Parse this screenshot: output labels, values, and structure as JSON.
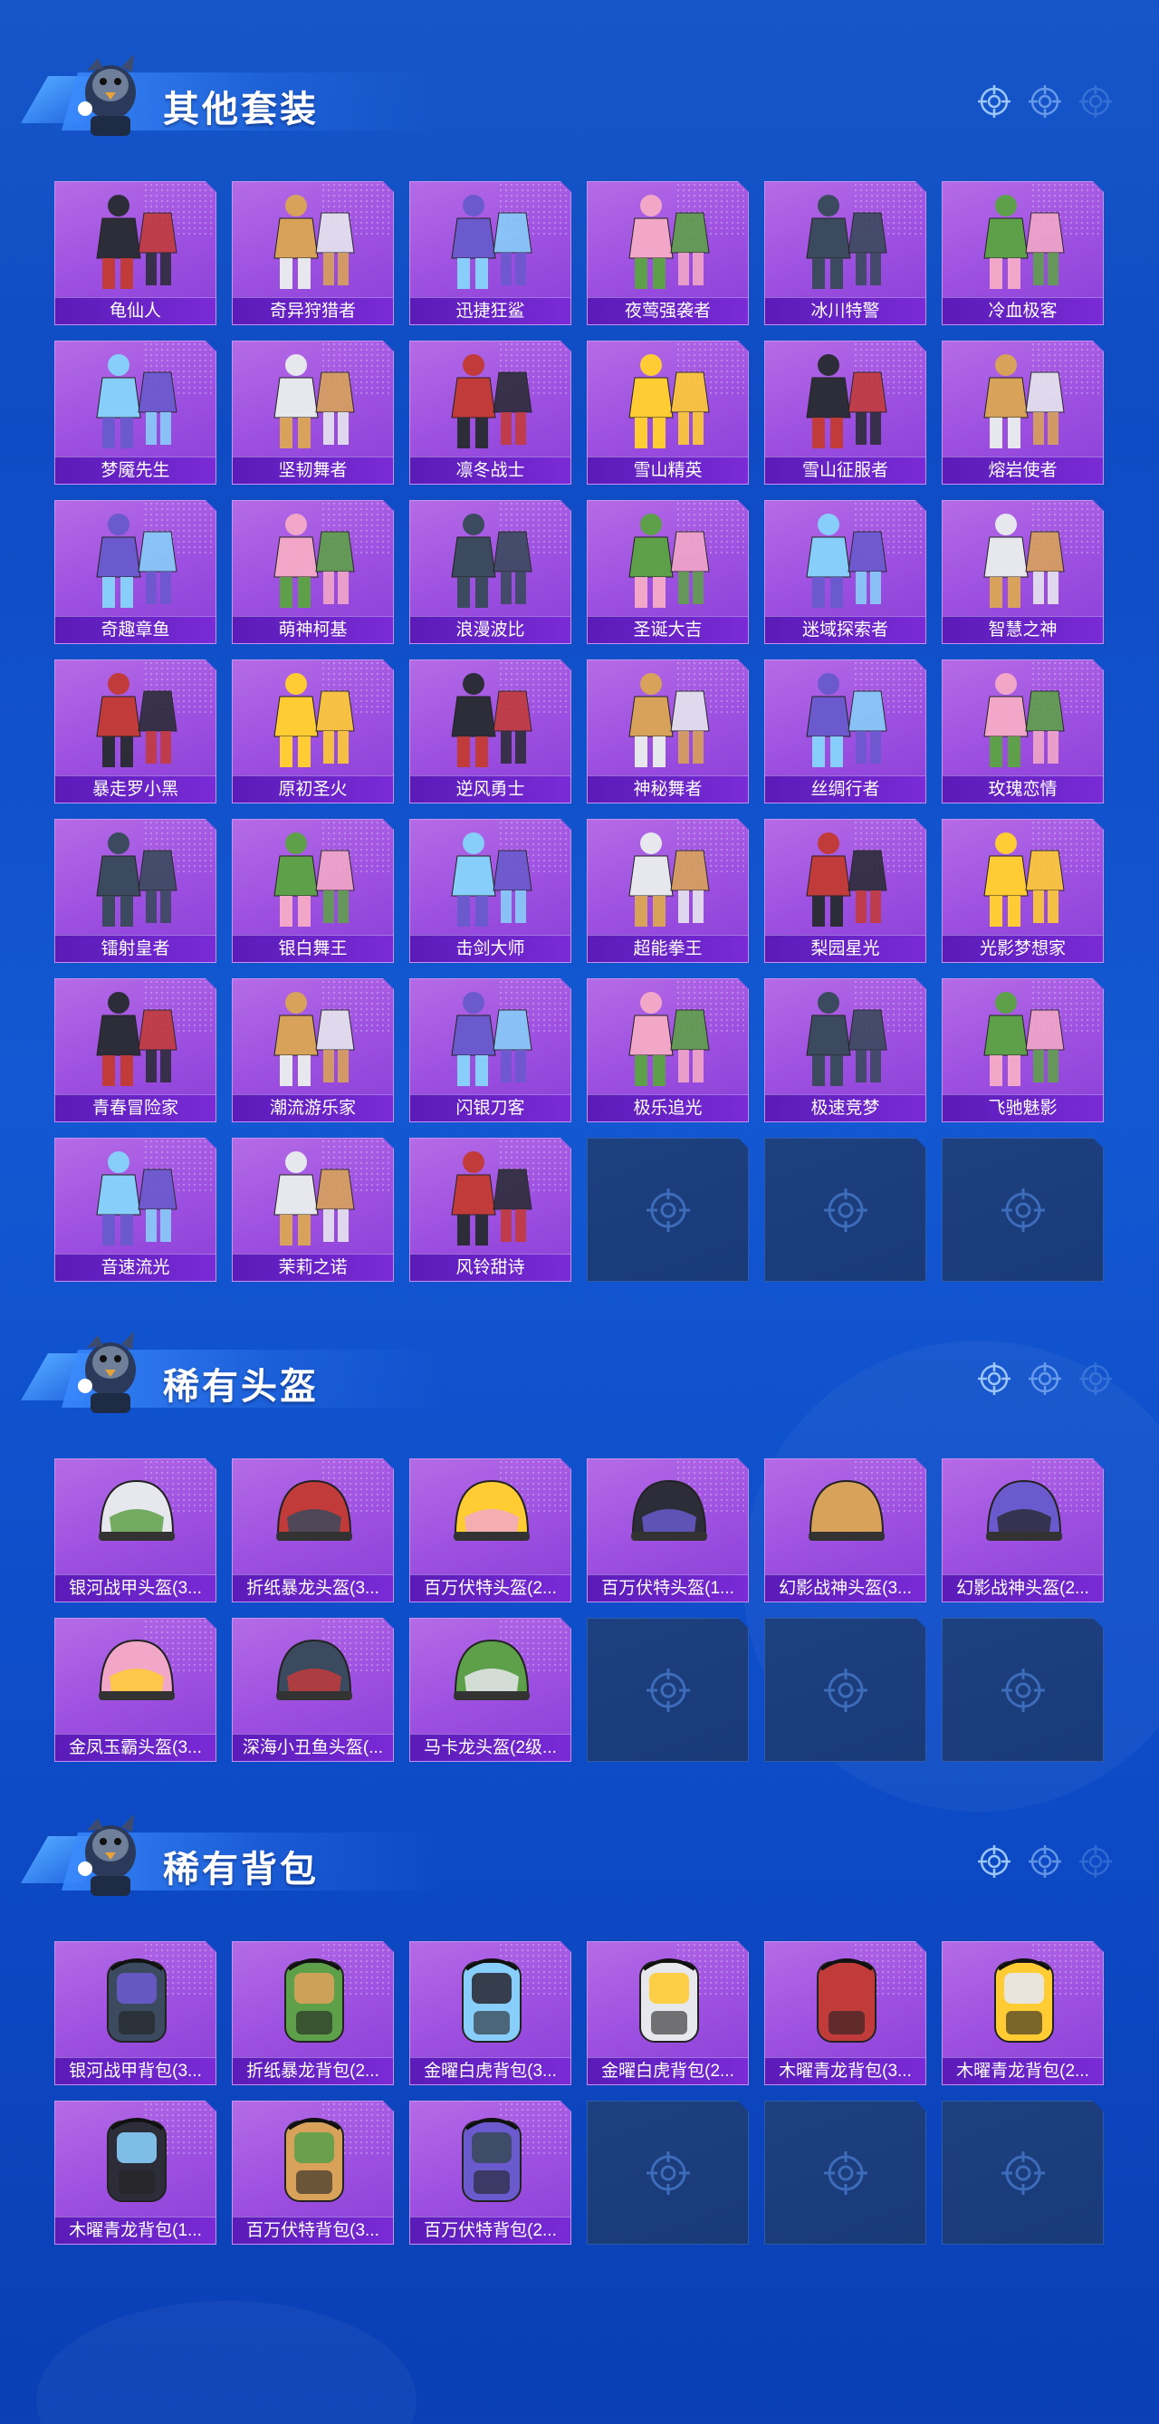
{
  "sections": [
    {
      "title": "其他套装",
      "items": [
        "龟仙人",
        "奇异狩猎者",
        "迅捷狂鲨",
        "夜莺强袭者",
        "冰川特警",
        "冷血极客",
        "梦魇先生",
        "坚韧舞者",
        "凛冬战士",
        "雪山精英",
        "雪山征服者",
        "熔岩使者",
        "奇趣章鱼",
        "萌神柯基",
        "浪漫波比",
        "圣诞大吉",
        "迷域探索者",
        "智慧之神",
        "暴走罗小黑",
        "原初圣火",
        "逆风勇士",
        "神秘舞者",
        "丝绸行者",
        "玫瑰恋情",
        "镭射皇者",
        "银白舞王",
        "击剑大师",
        "超能拳王",
        "梨园星光",
        "光影梦想家",
        "青春冒险家",
        "潮流游乐家",
        "闪银刀客",
        "极乐追光",
        "极速竞梦",
        "飞驰魅影",
        "音速流光",
        "茉莉之诺",
        "风铃甜诗"
      ],
      "empty_slots": 3
    },
    {
      "title": "稀有头盔",
      "items": [
        "银河战甲头盔(3...",
        "折纸暴龙头盔(3...",
        "百万伏特头盔(2...",
        "百万伏特头盔(1...",
        "幻影战神头盔(3...",
        "幻影战神头盔(2...",
        "金凤玉霸头盔(3...",
        "深海小丑鱼头盔(...",
        "马卡龙头盔(2级..."
      ],
      "empty_slots": 3
    },
    {
      "title": "稀有背包",
      "items": [
        "银河战甲背包(3...",
        "折纸暴龙背包(2...",
        "金曜白虎背包(3...",
        "金曜白虎背包(2...",
        "木曜青龙背包(3...",
        "木曜青龙背包(2...",
        "木曜青龙背包(1...",
        "百万伏特背包(3...",
        "百万伏特背包(2..."
      ],
      "empty_slots": 3
    }
  ],
  "colors": {
    "background": "#1358d2",
    "card": "#9c4fe0",
    "card_label": "#5a1bb8",
    "empty_card": "#1d4080"
  },
  "icons": {
    "section_decoration": "crosshair-target-icon",
    "empty_slot": "crosshair-placeholder-icon",
    "header_mascot": "chicken-mascot-icon"
  }
}
